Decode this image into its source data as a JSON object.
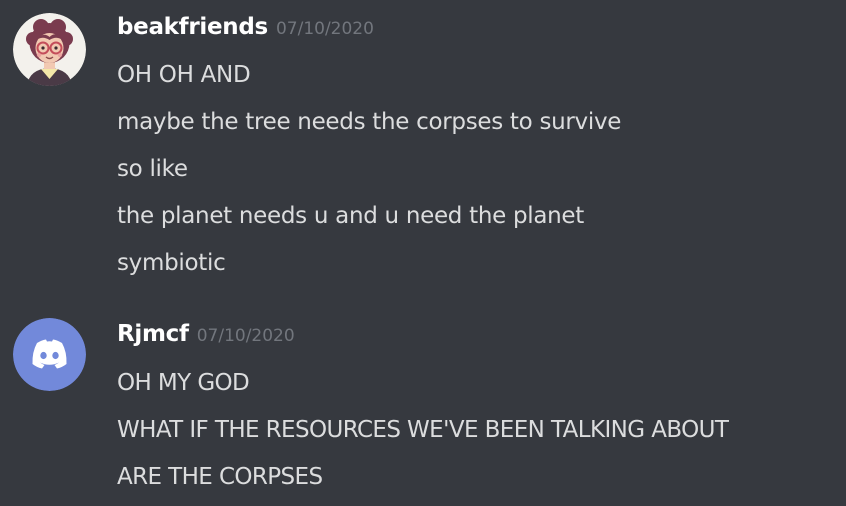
{
  "messages": [
    {
      "author": "beakfriends",
      "timestamp": "07/10/2020",
      "avatar_icon": "cartoon-avatar-icon",
      "lines": [
        "OH OH AND",
        "maybe the tree needs the corpses to survive",
        "so like",
        "the planet needs u and u need the planet",
        "symbiotic"
      ]
    },
    {
      "author": "Rjmcf",
      "timestamp": "07/10/2020",
      "avatar_icon": "discord-default-avatar-icon",
      "lines": [
        "OH MY GOD",
        "WHAT IF THE RESOURCES WE'VE BEEN TALKING ABOUT",
        "ARE THE CORPSES"
      ]
    }
  ],
  "colors": {
    "background": "#36393f",
    "username": "#ffffff",
    "timestamp": "#72767d",
    "message_text": "#dcddde",
    "discord_blurple": "#7289da"
  }
}
